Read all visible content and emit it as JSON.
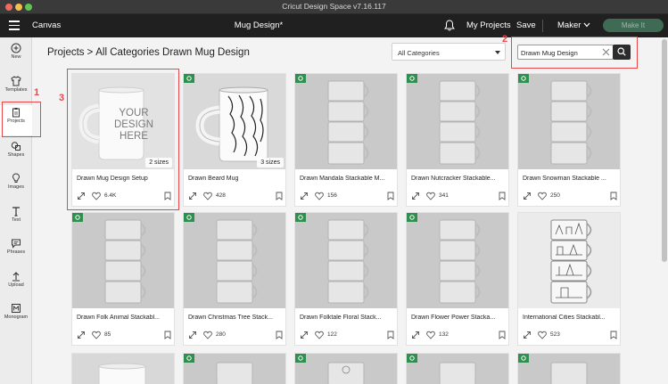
{
  "window": {
    "title": "Cricut Design Space  v7.16.117"
  },
  "header": {
    "app_name": "Canvas",
    "doc_title": "Mug Design*",
    "my_projects": "My Projects",
    "save": "Save",
    "machine": "Maker",
    "make_it": "Make It"
  },
  "sidebar": {
    "items": [
      {
        "label": "New",
        "icon": "plus-circle-icon"
      },
      {
        "label": "Templates",
        "icon": "shirt-icon"
      },
      {
        "label": "Projects",
        "icon": "clipboard-icon"
      },
      {
        "label": "Shapes",
        "icon": "shapes-icon"
      },
      {
        "label": "Images",
        "icon": "bulb-icon"
      },
      {
        "label": "Text",
        "icon": "text-t-icon"
      },
      {
        "label": "Phrases",
        "icon": "speech-bubble-icon"
      },
      {
        "label": "Upload",
        "icon": "upload-icon"
      },
      {
        "label": "Monogram",
        "icon": "monogram-icon"
      }
    ]
  },
  "annotations": {
    "one": "1",
    "two": "2",
    "three": "3"
  },
  "breadcrumb": {
    "root": "Projects",
    "separator": ">",
    "current": "All Categories Drawn Mug Design"
  },
  "filter": {
    "selected": "All Categories"
  },
  "search": {
    "value": "Drawn Mug Design",
    "placeholder": ""
  },
  "cards": [
    {
      "title": "Drawn Mug Design Setup",
      "likes": "6.4K",
      "sizes": "2 sizes",
      "mockup_text": "YOUR DESIGN HERE"
    },
    {
      "title": "Drawn Beard Mug",
      "likes": "428",
      "sizes": "3 sizes"
    },
    {
      "title": "Drawn Mandala Stackable M...",
      "likes": "156"
    },
    {
      "title": "Drawn Nutcracker Stackable...",
      "likes": "341"
    },
    {
      "title": "Drawn Snowman Stackable ...",
      "likes": "250"
    },
    {
      "title": "Drawn Folk Animal Stackabl...",
      "likes": "85"
    },
    {
      "title": "Drawn Christmas Tree Stack...",
      "likes": "280"
    },
    {
      "title": "Drawn Folktale Floral Stack...",
      "likes": "122"
    },
    {
      "title": "Drawn Flower Power Stacka...",
      "likes": "132"
    },
    {
      "title": "International Cities Stackabl...",
      "likes": "523"
    }
  ],
  "colors": {
    "accent_green": "#2f8f4e",
    "annotation_red": "#e8474a",
    "header_bg": "#202020"
  }
}
